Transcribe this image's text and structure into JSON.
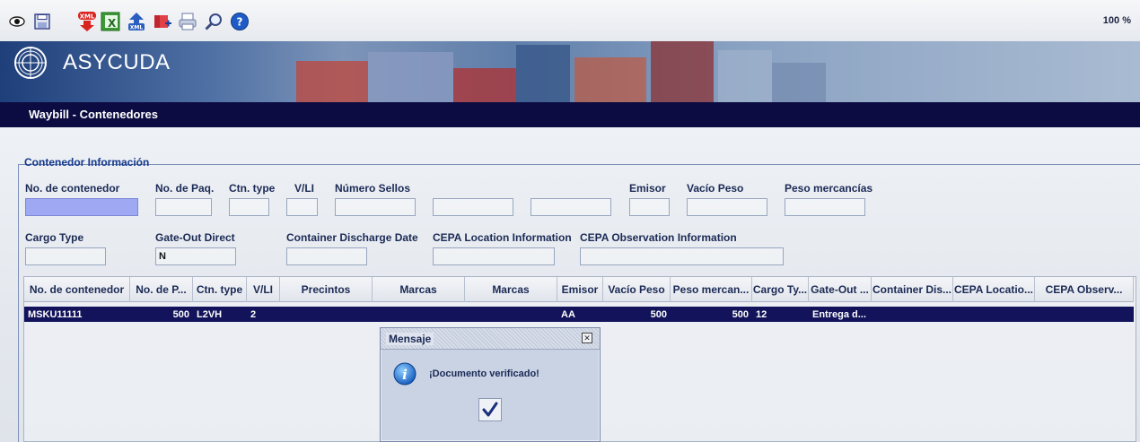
{
  "toolbar": {
    "icons": [
      "eye-icon",
      "save-icon",
      "xml-export-icon",
      "excel-icon",
      "xml-import-icon",
      "attach-document-icon",
      "print-icon",
      "search-icon",
      "help-icon"
    ],
    "zoom": "100 %"
  },
  "banner": {
    "brand": "ASYCUDA"
  },
  "window": {
    "title": "Waybill - Contenedores"
  },
  "form": {
    "legend": "Contenedor Información",
    "labels": {
      "container_no": "No. de contenedor",
      "packages": "No. de Paq.",
      "ctn_type": "Ctn. type",
      "vli": "V/LI",
      "seals": "Número Sellos",
      "issuer": "Emisor",
      "empty_weight": "Vacío Peso",
      "goods_weight": "Peso mercancías",
      "cargo_type": "Cargo Type",
      "gate_out": "Gate-Out Direct",
      "discharge_date": "Container Discharge Date",
      "cepa_location": "CEPA Location Information",
      "cepa_observation": "CEPA Observation Information"
    },
    "values": {
      "gate_out": "N"
    }
  },
  "grid": {
    "columns": [
      "No. de contenedor",
      "No. de P...",
      "Ctn. type",
      "V/LI",
      "Precintos",
      "Marcas",
      "Marcas",
      "Emisor",
      "Vacío Peso",
      "Peso mercan...",
      "Cargo Ty...",
      "Gate-Out ...",
      "Container Dis...",
      "CEPA Locatio...",
      "CEPA Observ..."
    ],
    "rows": [
      [
        "MSKU11111",
        "500",
        "L2VH",
        "2",
        "",
        "",
        "",
        "AA",
        "500",
        "500",
        "12",
        "Entrega d...",
        "",
        "",
        ""
      ]
    ]
  },
  "dialog": {
    "title": "Mensaje",
    "message": "¡Documento verificado!",
    "ok_icon": "checkmark-icon",
    "info_icon": "info-icon"
  },
  "colors": {
    "titlebar": "#0c0c42",
    "selected_row": "#12135a",
    "active_input": "#9fa8f2",
    "legend_text": "#163a8c"
  }
}
